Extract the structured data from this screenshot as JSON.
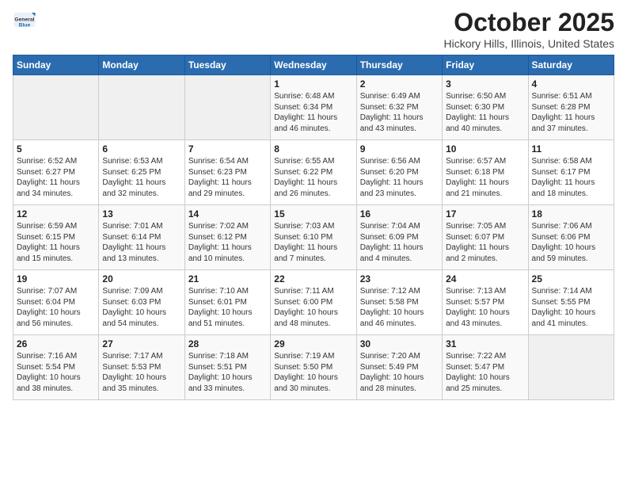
{
  "logo": {
    "general": "General",
    "blue": "Blue"
  },
  "title": "October 2025",
  "location": "Hickory Hills, Illinois, United States",
  "headers": [
    "Sunday",
    "Monday",
    "Tuesday",
    "Wednesday",
    "Thursday",
    "Friday",
    "Saturday"
  ],
  "weeks": [
    [
      {
        "day": "",
        "lines": []
      },
      {
        "day": "",
        "lines": []
      },
      {
        "day": "",
        "lines": []
      },
      {
        "day": "1",
        "lines": [
          "Sunrise: 6:48 AM",
          "Sunset: 6:34 PM",
          "Daylight: 11 hours",
          "and 46 minutes."
        ]
      },
      {
        "day": "2",
        "lines": [
          "Sunrise: 6:49 AM",
          "Sunset: 6:32 PM",
          "Daylight: 11 hours",
          "and 43 minutes."
        ]
      },
      {
        "day": "3",
        "lines": [
          "Sunrise: 6:50 AM",
          "Sunset: 6:30 PM",
          "Daylight: 11 hours",
          "and 40 minutes."
        ]
      },
      {
        "day": "4",
        "lines": [
          "Sunrise: 6:51 AM",
          "Sunset: 6:28 PM",
          "Daylight: 11 hours",
          "and 37 minutes."
        ]
      }
    ],
    [
      {
        "day": "5",
        "lines": [
          "Sunrise: 6:52 AM",
          "Sunset: 6:27 PM",
          "Daylight: 11 hours",
          "and 34 minutes."
        ]
      },
      {
        "day": "6",
        "lines": [
          "Sunrise: 6:53 AM",
          "Sunset: 6:25 PM",
          "Daylight: 11 hours",
          "and 32 minutes."
        ]
      },
      {
        "day": "7",
        "lines": [
          "Sunrise: 6:54 AM",
          "Sunset: 6:23 PM",
          "Daylight: 11 hours",
          "and 29 minutes."
        ]
      },
      {
        "day": "8",
        "lines": [
          "Sunrise: 6:55 AM",
          "Sunset: 6:22 PM",
          "Daylight: 11 hours",
          "and 26 minutes."
        ]
      },
      {
        "day": "9",
        "lines": [
          "Sunrise: 6:56 AM",
          "Sunset: 6:20 PM",
          "Daylight: 11 hours",
          "and 23 minutes."
        ]
      },
      {
        "day": "10",
        "lines": [
          "Sunrise: 6:57 AM",
          "Sunset: 6:18 PM",
          "Daylight: 11 hours",
          "and 21 minutes."
        ]
      },
      {
        "day": "11",
        "lines": [
          "Sunrise: 6:58 AM",
          "Sunset: 6:17 PM",
          "Daylight: 11 hours",
          "and 18 minutes."
        ]
      }
    ],
    [
      {
        "day": "12",
        "lines": [
          "Sunrise: 6:59 AM",
          "Sunset: 6:15 PM",
          "Daylight: 11 hours",
          "and 15 minutes."
        ]
      },
      {
        "day": "13",
        "lines": [
          "Sunrise: 7:01 AM",
          "Sunset: 6:14 PM",
          "Daylight: 11 hours",
          "and 13 minutes."
        ]
      },
      {
        "day": "14",
        "lines": [
          "Sunrise: 7:02 AM",
          "Sunset: 6:12 PM",
          "Daylight: 11 hours",
          "and 10 minutes."
        ]
      },
      {
        "day": "15",
        "lines": [
          "Sunrise: 7:03 AM",
          "Sunset: 6:10 PM",
          "Daylight: 11 hours",
          "and 7 minutes."
        ]
      },
      {
        "day": "16",
        "lines": [
          "Sunrise: 7:04 AM",
          "Sunset: 6:09 PM",
          "Daylight: 11 hours",
          "and 4 minutes."
        ]
      },
      {
        "day": "17",
        "lines": [
          "Sunrise: 7:05 AM",
          "Sunset: 6:07 PM",
          "Daylight: 11 hours",
          "and 2 minutes."
        ]
      },
      {
        "day": "18",
        "lines": [
          "Sunrise: 7:06 AM",
          "Sunset: 6:06 PM",
          "Daylight: 10 hours",
          "and 59 minutes."
        ]
      }
    ],
    [
      {
        "day": "19",
        "lines": [
          "Sunrise: 7:07 AM",
          "Sunset: 6:04 PM",
          "Daylight: 10 hours",
          "and 56 minutes."
        ]
      },
      {
        "day": "20",
        "lines": [
          "Sunrise: 7:09 AM",
          "Sunset: 6:03 PM",
          "Daylight: 10 hours",
          "and 54 minutes."
        ]
      },
      {
        "day": "21",
        "lines": [
          "Sunrise: 7:10 AM",
          "Sunset: 6:01 PM",
          "Daylight: 10 hours",
          "and 51 minutes."
        ]
      },
      {
        "day": "22",
        "lines": [
          "Sunrise: 7:11 AM",
          "Sunset: 6:00 PM",
          "Daylight: 10 hours",
          "and 48 minutes."
        ]
      },
      {
        "day": "23",
        "lines": [
          "Sunrise: 7:12 AM",
          "Sunset: 5:58 PM",
          "Daylight: 10 hours",
          "and 46 minutes."
        ]
      },
      {
        "day": "24",
        "lines": [
          "Sunrise: 7:13 AM",
          "Sunset: 5:57 PM",
          "Daylight: 10 hours",
          "and 43 minutes."
        ]
      },
      {
        "day": "25",
        "lines": [
          "Sunrise: 7:14 AM",
          "Sunset: 5:55 PM",
          "Daylight: 10 hours",
          "and 41 minutes."
        ]
      }
    ],
    [
      {
        "day": "26",
        "lines": [
          "Sunrise: 7:16 AM",
          "Sunset: 5:54 PM",
          "Daylight: 10 hours",
          "and 38 minutes."
        ]
      },
      {
        "day": "27",
        "lines": [
          "Sunrise: 7:17 AM",
          "Sunset: 5:53 PM",
          "Daylight: 10 hours",
          "and 35 minutes."
        ]
      },
      {
        "day": "28",
        "lines": [
          "Sunrise: 7:18 AM",
          "Sunset: 5:51 PM",
          "Daylight: 10 hours",
          "and 33 minutes."
        ]
      },
      {
        "day": "29",
        "lines": [
          "Sunrise: 7:19 AM",
          "Sunset: 5:50 PM",
          "Daylight: 10 hours",
          "and 30 minutes."
        ]
      },
      {
        "day": "30",
        "lines": [
          "Sunrise: 7:20 AM",
          "Sunset: 5:49 PM",
          "Daylight: 10 hours",
          "and 28 minutes."
        ]
      },
      {
        "day": "31",
        "lines": [
          "Sunrise: 7:22 AM",
          "Sunset: 5:47 PM",
          "Daylight: 10 hours",
          "and 25 minutes."
        ]
      },
      {
        "day": "",
        "lines": []
      }
    ]
  ]
}
